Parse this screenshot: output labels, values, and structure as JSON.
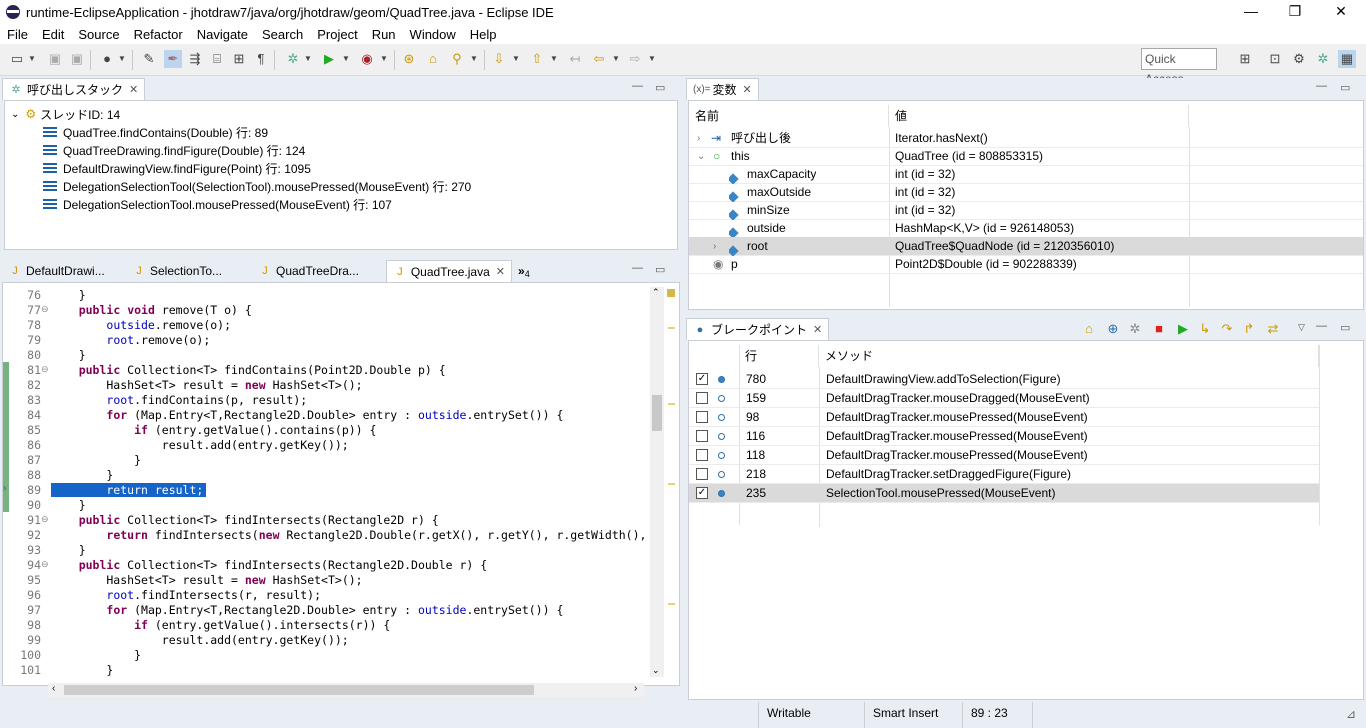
{
  "window": {
    "title": "runtime-EclipseApplication - jhotdraw7/java/org/jhotdraw/geom/QuadTree.java - Eclipse IDE",
    "minimize": "—",
    "maximize": "❐",
    "close": "✕"
  },
  "menu": [
    "File",
    "Edit",
    "Source",
    "Refactor",
    "Navigate",
    "Search",
    "Project",
    "Run",
    "Window",
    "Help"
  ],
  "toolbar": {
    "quick_access": "Quick Access"
  },
  "callstack": {
    "tab_label": "呼び出しスタック",
    "thread": "スレッドID: 14",
    "frames": [
      "QuadTree.findContains(Double) 行: 89",
      "QuadTreeDrawing.findFigure(Double) 行: 124",
      "DefaultDrawingView.findFigure(Point) 行: 1095",
      "DelegationSelectionTool(SelectionTool).mousePressed(MouseEvent) 行: 270",
      "DelegationSelectionTool.mousePressed(MouseEvent) 行: 107"
    ]
  },
  "editor": {
    "tabs": [
      "DefaultDrawi...",
      "SelectionTo...",
      "QuadTreeDra...",
      "QuadTree.java"
    ],
    "overflow_count": "4",
    "lines": [
      {
        "n": "76",
        "fold": "",
        "code": "    }"
      },
      {
        "n": "77",
        "fold": "⊖",
        "code": "    public void remove(T o) {"
      },
      {
        "n": "78",
        "fold": "",
        "code": "        outside.remove(o);"
      },
      {
        "n": "79",
        "fold": "",
        "code": "        root.remove(o);"
      },
      {
        "n": "80",
        "fold": "",
        "code": "    }"
      },
      {
        "n": "81",
        "fold": "⊖",
        "code": "    public Collection<T> findContains(Point2D.Double p) {"
      },
      {
        "n": "82",
        "fold": "",
        "code": "        HashSet<T> result = new HashSet<T>();"
      },
      {
        "n": "83",
        "fold": "",
        "code": "        root.findContains(p, result);"
      },
      {
        "n": "84",
        "fold": "",
        "code": "        for (Map.Entry<T,Rectangle2D.Double> entry : outside.entrySet()) {"
      },
      {
        "n": "85",
        "fold": "",
        "code": "            if (entry.getValue().contains(p)) {"
      },
      {
        "n": "86",
        "fold": "",
        "code": "                result.add(entry.getKey());"
      },
      {
        "n": "87",
        "fold": "",
        "code": "            }"
      },
      {
        "n": "88",
        "fold": "",
        "code": "        }"
      },
      {
        "n": "89",
        "fold": "",
        "code": "        return result;"
      },
      {
        "n": "90",
        "fold": "",
        "code": "    }"
      },
      {
        "n": "91",
        "fold": "⊖",
        "code": "    public Collection<T> findIntersects(Rectangle2D r) {"
      },
      {
        "n": "92",
        "fold": "",
        "code": "        return findIntersects(new Rectangle2D.Double(r.getX(), r.getY(), r.getWidth(),"
      },
      {
        "n": "93",
        "fold": "",
        "code": "    }"
      },
      {
        "n": "94",
        "fold": "⊖",
        "code": "    public Collection<T> findIntersects(Rectangle2D.Double r) {"
      },
      {
        "n": "95",
        "fold": "",
        "code": "        HashSet<T> result = new HashSet<T>();"
      },
      {
        "n": "96",
        "fold": "",
        "code": "        root.findIntersects(r, result);"
      },
      {
        "n": "97",
        "fold": "",
        "code": "        for (Map.Entry<T,Rectangle2D.Double> entry : outside.entrySet()) {"
      },
      {
        "n": "98",
        "fold": "",
        "code": "            if (entry.getValue().intersects(r)) {"
      },
      {
        "n": "99",
        "fold": "",
        "code": "                result.add(entry.getKey());"
      },
      {
        "n": "100",
        "fold": "",
        "code": "            }"
      },
      {
        "n": "101",
        "fold": "",
        "code": "        }"
      }
    ]
  },
  "variables": {
    "tab_label": "変数",
    "tab_prefix": "(x)=",
    "col_name": "名前",
    "col_value": "値",
    "rows": [
      {
        "name": "呼び出し後",
        "value": "Iterator.hasNext()"
      },
      {
        "name": "this",
        "value": "QuadTree  (id = 808853315)"
      },
      {
        "name": "maxCapacity",
        "value": "int  (id = 32)"
      },
      {
        "name": "maxOutside",
        "value": "int  (id = 32)"
      },
      {
        "name": "minSize",
        "value": "int  (id = 32)"
      },
      {
        "name": "outside",
        "value": "HashMap<K,V>  (id = 926148053)"
      },
      {
        "name": "root",
        "value": "QuadTree$QuadNode  (id = 2120356010)"
      },
      {
        "name": "p",
        "value": "Point2D$Double  (id = 902288339)"
      }
    ]
  },
  "breakpoints": {
    "tab_label": "ブレークポイント",
    "col_line": "行",
    "col_method": "メソッド",
    "rows": [
      {
        "checked": true,
        "line": "780",
        "method": "DefaultDrawingView.addToSelection(Figure)"
      },
      {
        "checked": false,
        "line": "159",
        "method": "DefaultDragTracker.mouseDragged(MouseEvent)"
      },
      {
        "checked": false,
        "line": "98",
        "method": "DefaultDragTracker.mousePressed(MouseEvent)"
      },
      {
        "checked": false,
        "line": "116",
        "method": "DefaultDragTracker.mousePressed(MouseEvent)"
      },
      {
        "checked": false,
        "line": "118",
        "method": "DefaultDragTracker.mousePressed(MouseEvent)"
      },
      {
        "checked": false,
        "line": "218",
        "method": "DefaultDragTracker.setDraggedFigure(Figure)"
      },
      {
        "checked": true,
        "line": "235",
        "method": "SelectionTool.mousePressed(MouseEvent)"
      }
    ]
  },
  "status": {
    "writable": "Writable",
    "insert_mode": "Smart Insert",
    "position": "89 : 23"
  }
}
